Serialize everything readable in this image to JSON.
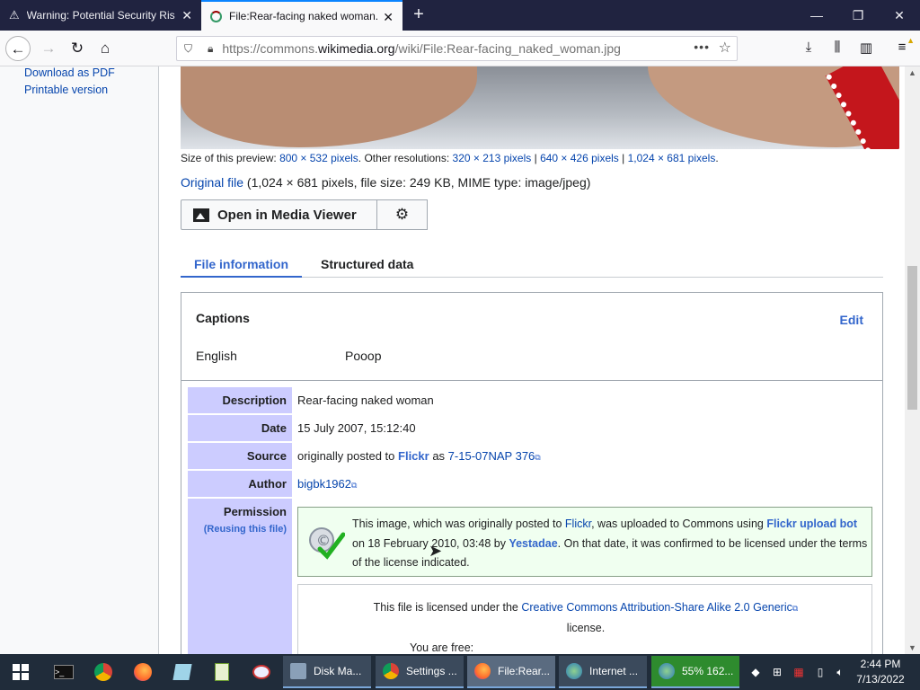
{
  "browser": {
    "tabs": [
      {
        "label": "Warning: Potential Security Risk",
        "icon": "warning-icon",
        "active": false
      },
      {
        "label": "File:Rear-facing naked woman.jpg",
        "icon": "wikimedia-icon",
        "active": true
      }
    ],
    "url_prefix": "https://commons.",
    "url_domain": "wikimedia.org",
    "url_path": "/wiki/File:Rear-facing_naked_woman.jpg"
  },
  "sidebar": {
    "links": [
      "Download as PDF",
      "Printable version"
    ]
  },
  "preview": {
    "size_label": "Size of this preview:",
    "size_preview": "800 × 532 pixels",
    "other_label": ". Other resolutions:",
    "res1": "320 × 213 pixels",
    "res2": "640 × 426 pixels",
    "res3": "1,024 × 681 pixels",
    "sep": " | ",
    "end": "."
  },
  "original": {
    "link": "Original file",
    "details": " (1,024 × 681 pixels, file size: 249 KB, MIME type: image/jpeg)"
  },
  "media_viewer_button": "Open in Media Viewer",
  "content_tabs": [
    "File information",
    "Structured data"
  ],
  "captions": {
    "heading": "Captions",
    "edit": "Edit",
    "language": "English",
    "value": "Pooop"
  },
  "info": {
    "description_label": "Description",
    "description": "Rear-facing naked woman",
    "date_label": "Date",
    "date": "15 July 2007, 15:12:40",
    "source_label": "Source",
    "source_pre": "originally posted to ",
    "source_site": "Flickr",
    "source_mid": " as ",
    "source_link": "7-15-07NAP 376",
    "author_label": "Author",
    "author": "bigbk1962",
    "permission_label": "Permission",
    "permission_sub": "(Reusing this file)"
  },
  "permission_box": {
    "t1": "This image, which was originally posted to ",
    "flickr": "Flickr",
    "t2": ", was uploaded to Commons using ",
    "bot": "Flickr upload bot",
    "t3": " on 18 February 2010, 03:48 by ",
    "user": "Yestadae",
    "t4": ". On that date, it was confirmed to be licensed under the terms of the license indicated."
  },
  "license_box": {
    "pre": "This file is licensed under the ",
    "link": "Creative Commons Attribution-Share Alike 2.0 Generic",
    "post": "license.",
    "free": "You are free:"
  },
  "taskbar": {
    "apps": [
      {
        "label": "Disk Ma..."
      },
      {
        "label": "Settings ..."
      },
      {
        "label": "File:Rear..."
      },
      {
        "label": "Internet ..."
      },
      {
        "label": "55% 162..."
      }
    ],
    "time": "2:44 PM",
    "date": "7/13/2022"
  },
  "colors": {
    "link": "#0645ad",
    "progressive": "#36c",
    "label_bg": "#ccccff",
    "taskbar": "#202c3a",
    "tabstrip": "#202340"
  }
}
